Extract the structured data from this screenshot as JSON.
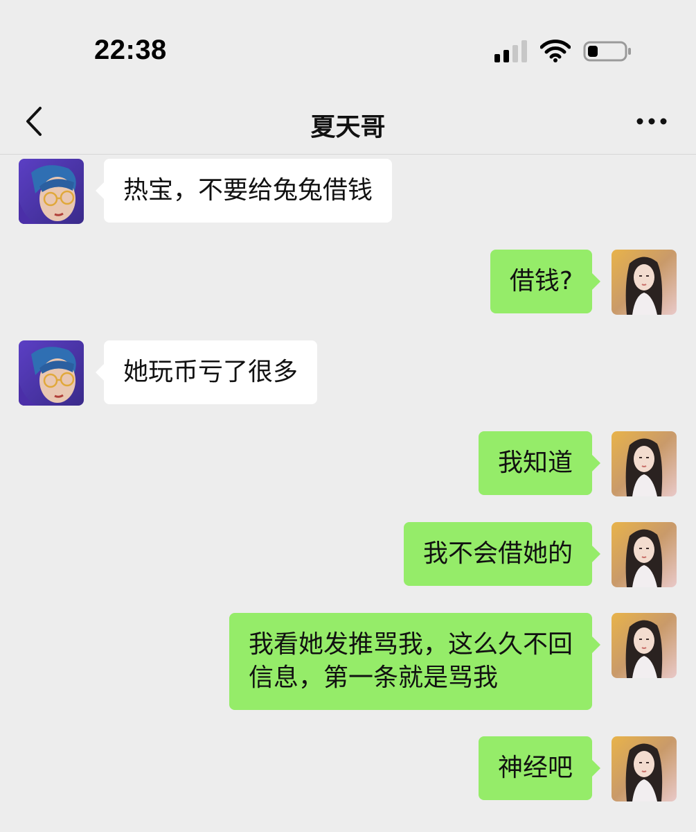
{
  "status_bar": {
    "time": "22:38",
    "signal_icon": "cellular-signal-icon",
    "wifi_icon": "wifi-icon",
    "battery_icon": "battery-low-icon"
  },
  "nav": {
    "title": "夏天哥",
    "back_icon": "chevron-left-icon",
    "more_icon": "more-dots-icon"
  },
  "colors": {
    "background": "#ededed",
    "incoming_bubble": "#ffffff",
    "outgoing_bubble": "#95ec69"
  },
  "messages": [
    {
      "sender": "contact",
      "lines": [
        "热宝，不要给兔兔借钱"
      ]
    },
    {
      "sender": "me",
      "lines": [
        "借钱?"
      ]
    },
    {
      "sender": "contact",
      "lines": [
        "她玩币亏了很多"
      ]
    },
    {
      "sender": "me",
      "lines": [
        "我知道"
      ]
    },
    {
      "sender": "me",
      "lines": [
        "我不会借她的"
      ]
    },
    {
      "sender": "me",
      "lines": [
        "我看她发推骂我，这么久不回",
        "信息，第一条就是骂我"
      ]
    },
    {
      "sender": "me",
      "lines": [
        "神经吧"
      ]
    }
  ]
}
